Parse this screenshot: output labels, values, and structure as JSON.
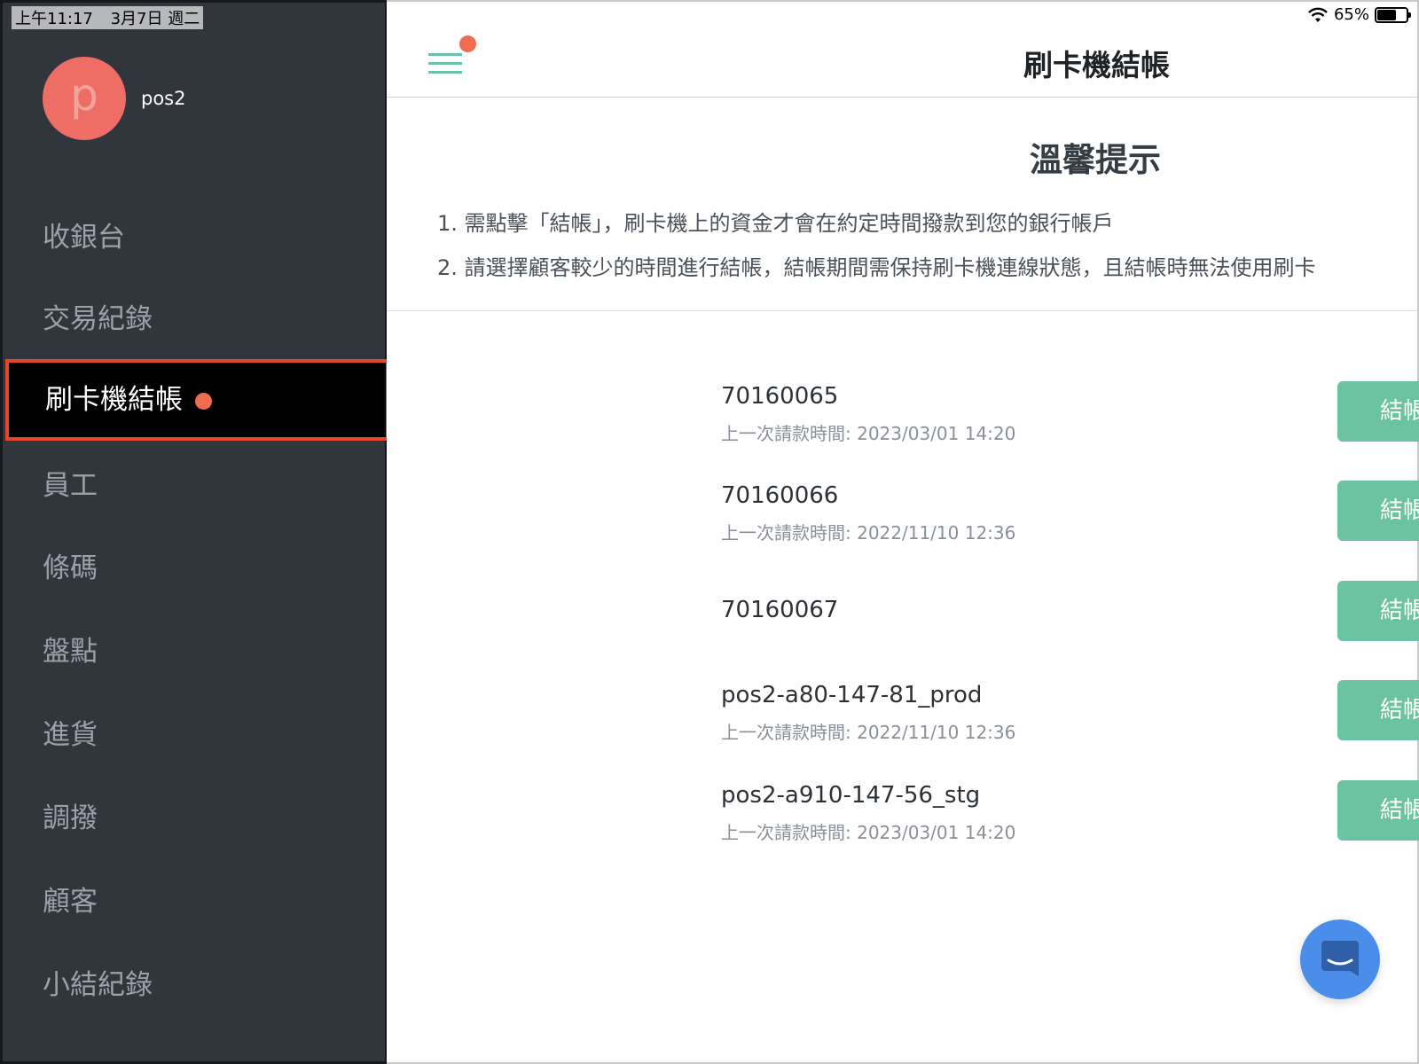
{
  "status_bar": {
    "time": "上午11:17",
    "date": "3月7日 週二",
    "battery": "65%",
    "battery_level": 0.65
  },
  "sidebar": {
    "avatar_letter": "p",
    "username": "pos2",
    "items": [
      {
        "label": "收銀台"
      },
      {
        "label": "交易紀錄"
      },
      {
        "label": "刷卡機結帳",
        "active": true
      },
      {
        "label": "員工"
      },
      {
        "label": "條碼"
      },
      {
        "label": "盤點"
      },
      {
        "label": "進貨"
      },
      {
        "label": "調撥"
      },
      {
        "label": "顧客"
      },
      {
        "label": "小結紀錄"
      }
    ]
  },
  "header": {
    "title": "刷卡機結帳"
  },
  "tips": {
    "title": "溫馨提示",
    "items": [
      "1. 需點擊「結帳」，刷卡機上的資金才會在約定時間撥款到您的銀行帳戶",
      "2. 請選擇顧客較少的時間進行結帳，結帳期間需保持刷卡機連線狀態，且結帳時無法使用刷卡"
    ]
  },
  "devices": [
    {
      "id": "70160065",
      "last_request": "上一次請款時間: 2023/03/01 14:20",
      "button": "結帳"
    },
    {
      "id": "70160066",
      "last_request": "上一次請款時間: 2022/11/10 12:36",
      "button": "結帳"
    },
    {
      "id": "70160067",
      "last_request": "",
      "button": "結帳"
    },
    {
      "id": "pos2-a80-147-81_prod",
      "last_request": "上一次請款時間: 2022/11/10 12:36",
      "button": "結帳"
    },
    {
      "id": "pos2-a910-147-56_stg",
      "last_request": "上一次請款時間: 2023/03/01 14:20",
      "button": "結帳"
    }
  ],
  "colors": {
    "sidebar_bg": "#31363d",
    "accent_green": "#6cc3a2",
    "notification_dot": "#ee6d51",
    "avatar": "#ee6d65",
    "chat_button": "#4a8ee9"
  },
  "icons": {
    "menu": "hamburger-menu-icon",
    "chat": "chat-icon",
    "wifi": "wifi-icon",
    "battery": "battery-icon"
  }
}
